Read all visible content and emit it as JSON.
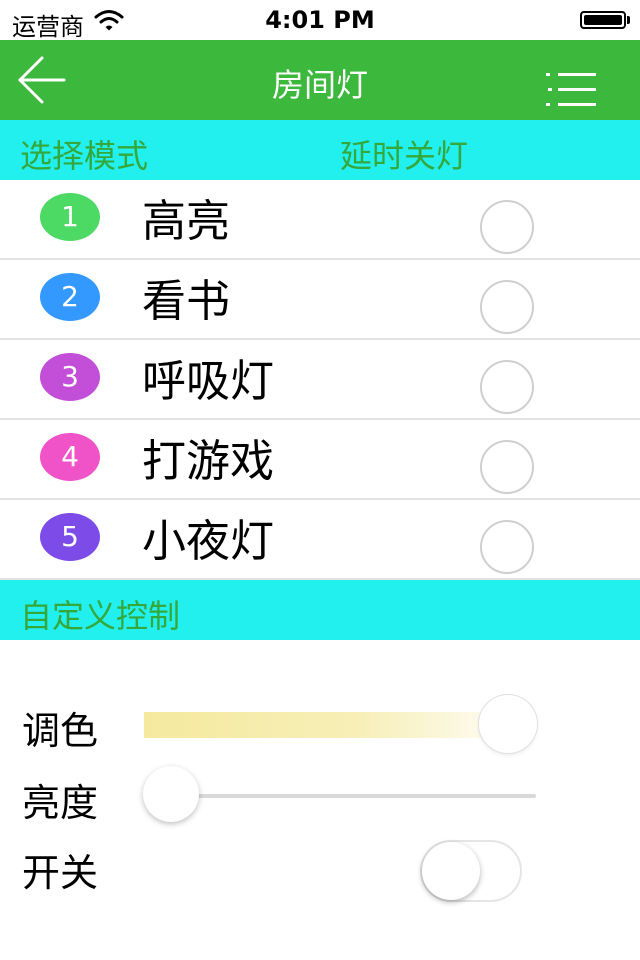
{
  "status_bar": {
    "carrier": "运营商",
    "time": "4:01 PM",
    "battery_level": 1.0
  },
  "nav": {
    "title": "房间灯",
    "back_icon": "arrow-left-icon",
    "menu_icon": "list-menu-icon",
    "background": "#3cb83c"
  },
  "mode_section": {
    "label": "选择模式",
    "delay_label": "延时关灯",
    "background": "#21f0ee",
    "text_color": "#35a83b"
  },
  "modes": [
    {
      "number": "1",
      "label": "高亮",
      "color": "#4cd964",
      "selected": false
    },
    {
      "number": "2",
      "label": "看书",
      "color": "#3399ff",
      "selected": false
    },
    {
      "number": "3",
      "label": "呼吸灯",
      "color": "#c34fd9",
      "selected": false
    },
    {
      "number": "4",
      "label": "打游戏",
      "color": "#f052c8",
      "selected": false
    },
    {
      "number": "5",
      "label": "小夜灯",
      "color": "#7d4ce8",
      "selected": false
    }
  ],
  "custom_section": {
    "label": "自定义控制"
  },
  "controls": {
    "color_label": "调色",
    "color_value": 1.0,
    "brightness_label": "亮度",
    "brightness_value": 0.0,
    "switch_label": "开关",
    "switch_on": false
  }
}
